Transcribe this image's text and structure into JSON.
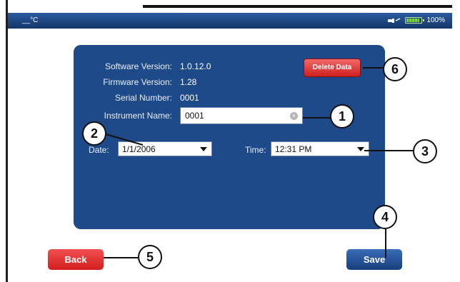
{
  "topbar": {
    "temperature_unit": "__°C",
    "battery_percent": "100%"
  },
  "settings": {
    "software_version_label": "Software Version:",
    "software_version": "1.0.12.0",
    "firmware_version_label": "Firmware Version:",
    "firmware_version": "1.28",
    "serial_number_label": "Serial Number:",
    "serial_number": "0001",
    "instrument_name_label": "Instrument Name:",
    "instrument_name": "0001",
    "date_label": "Date:",
    "date_value": "1/1/2006",
    "time_label": "Time:",
    "time_value": "12:31 PM"
  },
  "buttons": {
    "delete_data": "Delete Data",
    "back": "Back",
    "save": "Save"
  },
  "callouts": [
    "1",
    "2",
    "3",
    "4",
    "5",
    "6"
  ],
  "colors": {
    "panel": "#1f4a8a",
    "topbar": "#1c3f7a",
    "delete": "#cf1f1f",
    "back": "#d41d1d",
    "save": "#173f7c"
  },
  "icons": [
    "plug-icon",
    "battery-icon",
    "clear-icon",
    "chevron-down-icon"
  ]
}
